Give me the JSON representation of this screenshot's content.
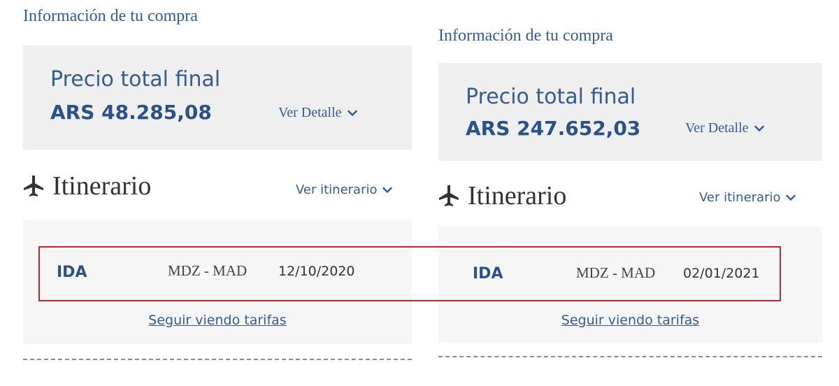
{
  "panels": [
    {
      "section_title": "Información de tu compra",
      "price_label": "Precio total final",
      "price_amount": "ARS 48.285,08",
      "detail_link": "Ver Detalle",
      "itinerary_title": "Itinerario",
      "itinerary_link": "Ver itinerario",
      "row": {
        "type": "IDA",
        "route": "MDZ - MAD",
        "date": "12/10/2020"
      },
      "fares_link": "Seguir viendo tarifas"
    },
    {
      "section_title": "Información de tu compra",
      "price_label": "Precio total final",
      "price_amount": "ARS 247.652,03",
      "detail_link": "Ver Detalle",
      "itinerary_title": "Itinerario",
      "itinerary_link": "Ver itinerario",
      "row": {
        "type": "IDA",
        "route": "MDZ - MAD",
        "date": "02/01/2021"
      },
      "fares_link": "Seguir viendo tarifas"
    }
  ],
  "icons": {
    "plane": "airplane-icon",
    "chevron": "chevron-down-icon"
  },
  "colors": {
    "brand_blue": "#345c93",
    "highlight_red": "#c1272d",
    "box_bg": "#efefef"
  }
}
